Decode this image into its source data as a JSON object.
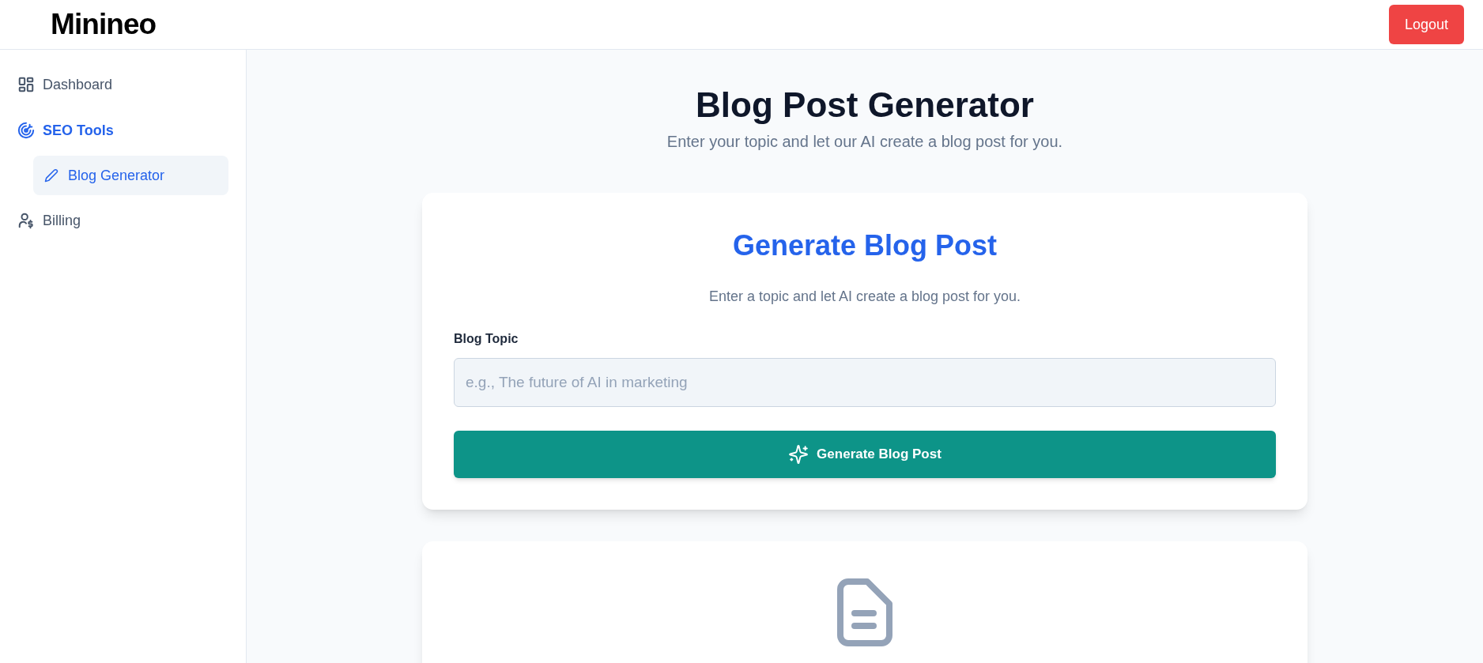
{
  "header": {
    "logo": "Minineo",
    "logout_button": "Logout"
  },
  "sidebar": {
    "items": [
      {
        "label": "Dashboard",
        "selected": false
      },
      {
        "label": "SEO Tools",
        "selected": true,
        "children": [
          {
            "label": "Blog Generator",
            "selected": true
          }
        ]
      },
      {
        "label": "Billing",
        "selected": false
      }
    ]
  },
  "page": {
    "title": "Blog Post Generator",
    "subtitle": "Enter your topic and let our AI create a blog post for you."
  },
  "form_card": {
    "title": "Generate Blog Post",
    "description": "Enter a topic and let AI create a blog post for you.",
    "field_label": "Blog Topic",
    "placeholder": "e.g., The future of AI in marketing",
    "submit_button": "Generate Blog Post"
  },
  "result_card": {
    "kind": "empty"
  }
}
